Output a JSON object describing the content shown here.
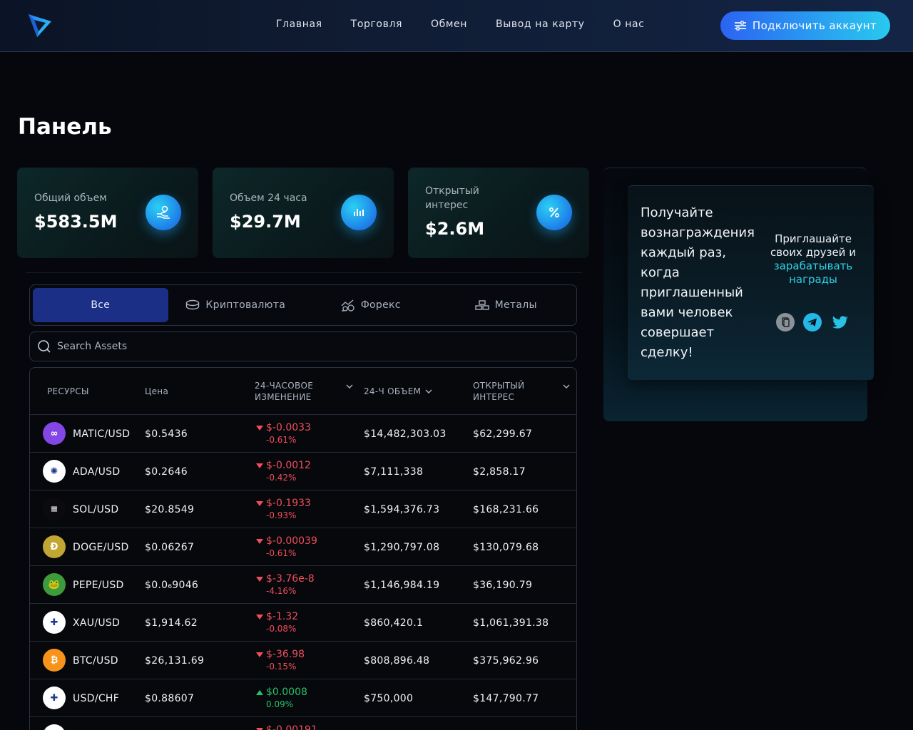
{
  "header": {
    "nav": [
      "Главная",
      "Торговля",
      "Обмен",
      "Вывод на карту",
      "О нас"
    ],
    "connect_label": "Подключить аккаунт"
  },
  "page_title": "Панель",
  "stats": [
    {
      "label": "Общий объем",
      "value": "$583.5M",
      "icon": "hand-coins-icon"
    },
    {
      "label": "Объем 24 часа",
      "value": "$29.7M",
      "icon": "bar-chart-icon"
    },
    {
      "label": "Открытый интерес",
      "value": "$2.6M",
      "icon": "percent-icon"
    }
  ],
  "referral": {
    "text": "Получайте вознаграждения каждый раз, когда приглашенный вами человек совершает сделку!",
    "invite_1": "Приглашайте своих друзей и",
    "invite_2": "зарабатывать награды"
  },
  "tabs": [
    "Все",
    "Криптовалюта",
    "Форекс",
    "Металы"
  ],
  "search": {
    "placeholder": "Search Assets"
  },
  "table": {
    "headers": [
      "РЕСУРСЫ",
      "Цена",
      "24-ЧАСОВОЕ ИЗМЕНЕНИЕ",
      "24-Ч ОБЪЕМ",
      "ОТКРЫТЫЙ ИНТЕРЕС"
    ],
    "rows": [
      {
        "asset": "MATIC/USD",
        "price": "$0.5436",
        "change": "$-0.0033",
        "pct": "-0.61%",
        "dir": "down",
        "volume": "$14,482,303.03",
        "oi": "$62,299.67",
        "icon_color": "#8247e5",
        "icon_text": "∞"
      },
      {
        "asset": "ADA/USD",
        "price": "$0.2646",
        "change": "$-0.0012",
        "pct": "-0.42%",
        "dir": "down",
        "volume": "$7,111,338",
        "oi": "$2,858.17",
        "icon_color": "#ffffff",
        "icon_text": "✺"
      },
      {
        "asset": "SOL/USD",
        "price": "$20.8549",
        "change": "$-0.1933",
        "pct": "-0.93%",
        "dir": "down",
        "volume": "$1,594,376.73",
        "oi": "$168,231.66",
        "icon_color": "#0b0b0f",
        "icon_text": "≡"
      },
      {
        "asset": "DOGE/USD",
        "price": "$0.06267",
        "change": "$-0.00039",
        "pct": "-0.61%",
        "dir": "down",
        "volume": "$1,290,797.08",
        "oi": "$130,079.68",
        "icon_color": "#c2a633",
        "icon_text": "Ð"
      },
      {
        "asset": "PEPE/USD",
        "price": "$0.0₆9046",
        "change": "$-3.76e-8",
        "pct": "-4.16%",
        "dir": "down",
        "volume": "$1,146,984.19",
        "oi": "$36,190.79",
        "icon_color": "#3d9b3d",
        "icon_text": "🐸"
      },
      {
        "asset": "XAU/USD",
        "price": "$1,914.62",
        "change": "$-1.32",
        "pct": "-0.08%",
        "dir": "down",
        "volume": "$860,420.1",
        "oi": "$1,061,391.38",
        "icon_color": "#ffffff",
        "icon_text": "✚"
      },
      {
        "asset": "BTC/USD",
        "price": "$26,131.69",
        "change": "$-36.98",
        "pct": "-0.15%",
        "dir": "down",
        "volume": "$808,896.48",
        "oi": "$375,962.96",
        "icon_color": "#f7931a",
        "icon_text": "₿"
      },
      {
        "asset": "USD/CHF",
        "price": "$0.88607",
        "change": "$0.0008",
        "pct": "0.09%",
        "dir": "up",
        "volume": "$750,000",
        "oi": "$147,790.77",
        "icon_color": "#ffffff",
        "icon_text": "✚"
      },
      {
        "asset": "",
        "price": "",
        "change": "$-0.00191",
        "pct": "",
        "dir": "down",
        "volume": "",
        "oi": "",
        "icon_color": "#ffffff",
        "icon_text": ""
      }
    ]
  }
}
